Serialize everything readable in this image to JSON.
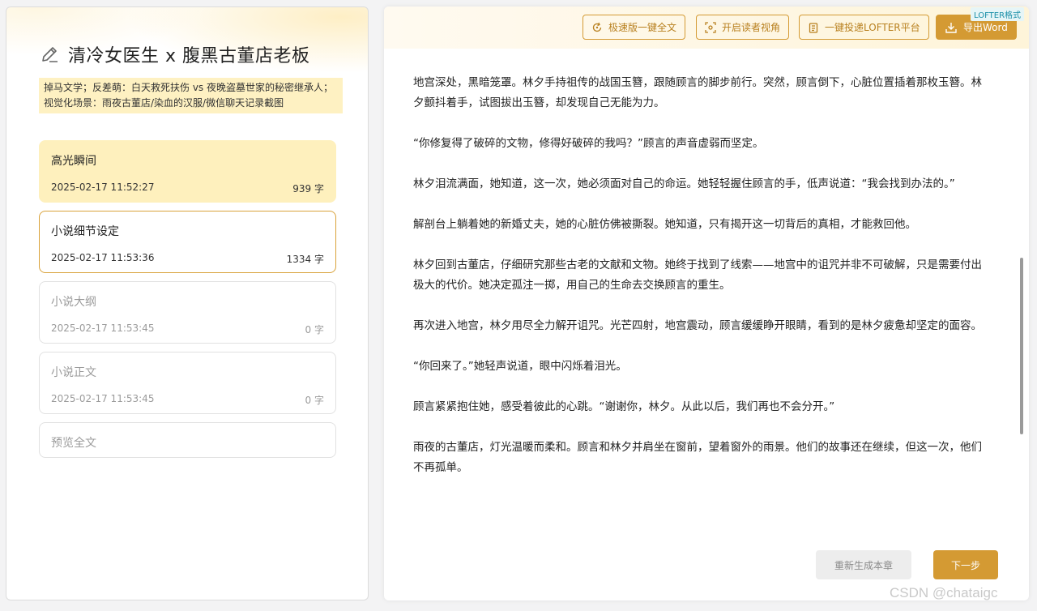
{
  "sidebar": {
    "title": "清冷女医生 x 腹黑古董店老板",
    "tags": "掉马文学；反差萌：白天救死扶伤 vs 夜晚盗墓世家的秘密继承人；视觉化场景：雨夜古董店/染血的汉服/微信聊天记录截图",
    "items": [
      {
        "label": "高光瞬间",
        "date": "2025-02-17 11:52:27",
        "count": "939 字"
      },
      {
        "label": "小说细节设定",
        "date": "2025-02-17 11:53:36",
        "count": "1334 字"
      },
      {
        "label": "小说大纲",
        "date": "2025-02-17 11:53:45",
        "count": "0 字"
      },
      {
        "label": "小说正文",
        "date": "2025-02-17 11:53:45",
        "count": "0 字"
      },
      {
        "label": "预览全文"
      }
    ]
  },
  "toolbar": {
    "fast_full": "极速版一键全文",
    "reader_view": "开启读者视角",
    "deliver_lofter": "一键投递LOFTER平台",
    "export_word": "导出Word",
    "lofter_badge": "LOFTER格式"
  },
  "content": {
    "paragraphs": [
      "地宫深处，黑暗笼罩。林夕手持祖传的战国玉簪，跟随顾言的脚步前行。突然，顾言倒下，心脏位置插着那枚玉簪。林夕颤抖着手，试图拔出玉簪，却发现自己无能为力。",
      "“你修复得了破碎的文物，修得好破碎的我吗？”顾言的声音虚弱而坚定。",
      "林夕泪流满面，她知道，这一次，她必须面对自己的命运。她轻轻握住顾言的手，低声说道：“我会找到办法的。”",
      "解剖台上躺着她的新婚丈夫，她的心脏仿佛被撕裂。她知道，只有揭开这一切背后的真相，才能救回他。",
      "林夕回到古董店，仔细研究那些古老的文献和文物。她终于找到了线索——地宫中的诅咒并非不可破解，只是需要付出极大的代价。她决定孤注一掷，用自己的生命去交换顾言的重生。",
      "再次进入地宫，林夕用尽全力解开诅咒。光芒四射，地宫震动，顾言缓缓睁开眼睛，看到的是林夕疲惫却坚定的面容。",
      "“你回来了。”她轻声说道，眼中闪烁着泪光。",
      "顾言紧紧抱住她，感受着彼此的心跳。“谢谢你，林夕。从此以后，我们再也不会分开。”",
      "雨夜的古董店，灯光温暖而柔和。顾言和林夕并肩坐在窗前，望着窗外的雨景。他们的故事还在继续，但这一次，他们不再孤单。"
    ]
  },
  "footer": {
    "regenerate": "重新生成本章",
    "next": "下一步"
  },
  "watermark": "CSDN @chataigc",
  "colors": {
    "accent": "#d49a33",
    "active_card": "#fef0bd",
    "tags_bg": "#fef1c2"
  }
}
